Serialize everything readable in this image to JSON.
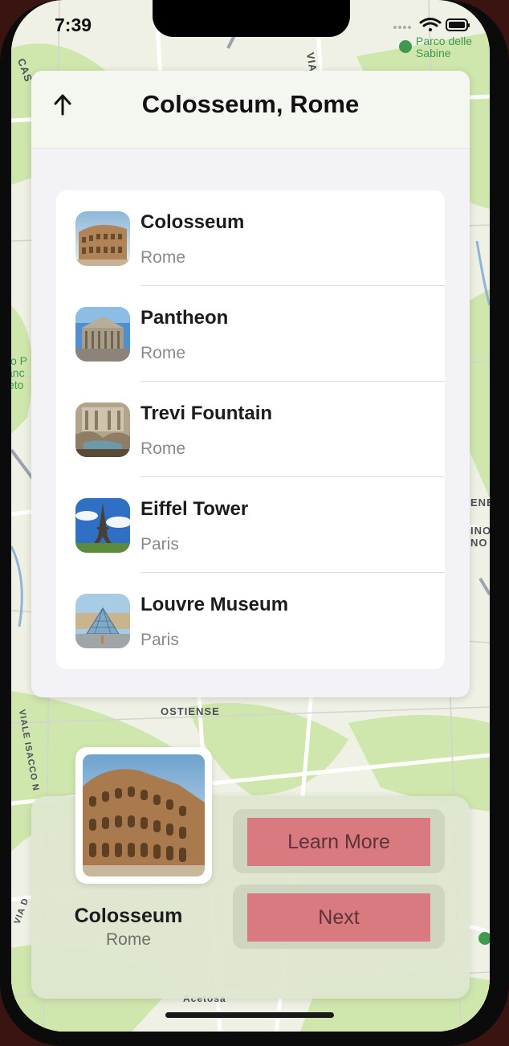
{
  "status_bar": {
    "time": "7:39"
  },
  "map": {
    "park_label_line1": "Parco delle",
    "park_label_line2": "Sabine",
    "left_label_1": "co P",
    "left_label_2": "anc",
    "left_label_3": "eto",
    "street_top_left": "CAS",
    "street_top": "VIA",
    "district": "OSTIENSE",
    "street_vertical": "VIALE ISACCO N",
    "right_label_1": "ENE",
    "right_label_2": "INO",
    "right_label_3": "NO",
    "street_bottom_left": "VIA D",
    "bottom_label": "Acetosa"
  },
  "header": {
    "title": "Colosseum, Rome",
    "back_icon": "arrow-up-icon"
  },
  "landmarks": [
    {
      "name": "Colosseum",
      "city": "Rome"
    },
    {
      "name": "Pantheon",
      "city": "Rome"
    },
    {
      "name": "Trevi Fountain",
      "city": "Rome"
    },
    {
      "name": "Eiffel Tower",
      "city": "Paris"
    },
    {
      "name": "Louvre Museum",
      "city": "Paris"
    }
  ],
  "card": {
    "name": "Colosseum",
    "city": "Rome",
    "learn_more_label": "Learn More",
    "next_label": "Next"
  },
  "colors": {
    "button_fill": "#d97a80",
    "button_text": "#5c3337",
    "map_green": "#cfe6ad",
    "park_green": "#3f9a4f"
  }
}
